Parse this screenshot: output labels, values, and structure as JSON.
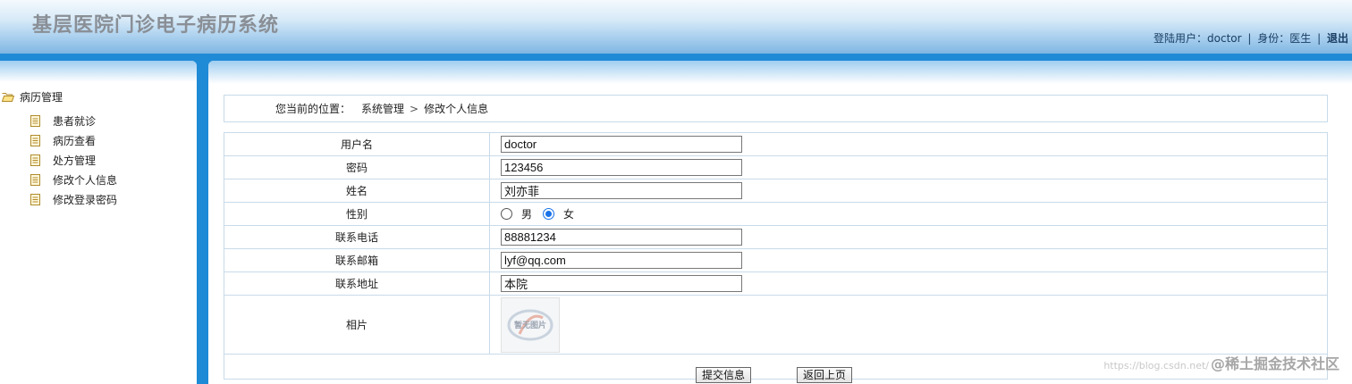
{
  "header": {
    "title": "基层医院门诊电子病历系统",
    "login_label": "登陆用户：doctor",
    "role_label": "身份：医生",
    "logout_label": "退出",
    "separator": "|"
  },
  "sidebar": {
    "group_label": "病历管理",
    "items": [
      {
        "label": "患者就诊"
      },
      {
        "label": "病历查看"
      },
      {
        "label": "处方管理"
      },
      {
        "label": "修改个人信息"
      },
      {
        "label": "修改登录密码"
      }
    ]
  },
  "breadcrumb": {
    "prefix": "您当前的位置：",
    "section": "系统管理",
    "arrow": ">",
    "page": "修改个人信息"
  },
  "form": {
    "username": {
      "label": "用户名",
      "value": "doctor"
    },
    "password": {
      "label": "密码",
      "value": "123456"
    },
    "name": {
      "label": "姓名",
      "value": "刘亦菲"
    },
    "gender": {
      "label": "性别",
      "male": "男",
      "female": "女",
      "selected": "女"
    },
    "phone": {
      "label": "联系电话",
      "value": "88881234"
    },
    "email": {
      "label": "联系邮箱",
      "value": "lyf@qq.com"
    },
    "address": {
      "label": "联系地址",
      "value": "本院"
    },
    "photo": {
      "label": "相片",
      "caption": "暂无图片"
    },
    "submit_label": "提交信息",
    "back_label": "返回上页"
  },
  "watermark": {
    "main": "@稀土掘金技术社区",
    "url": "https://blog.csdn.net/"
  }
}
